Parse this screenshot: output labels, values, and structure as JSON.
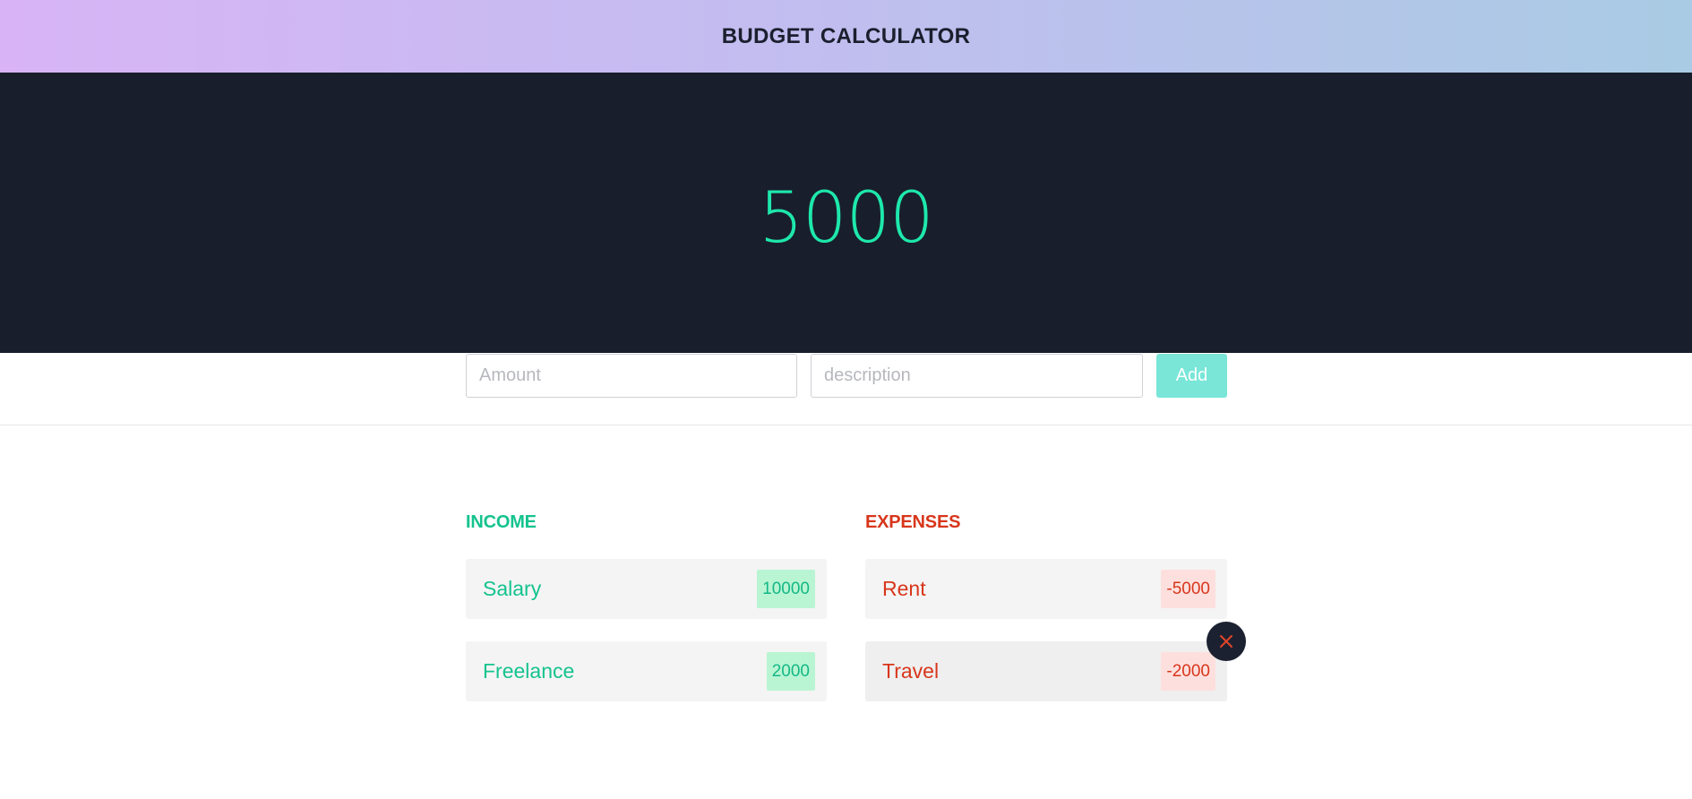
{
  "header": {
    "title": "BUDGET CALCULATOR"
  },
  "balance": {
    "value": "5000"
  },
  "form": {
    "amount_placeholder": "Amount",
    "description_placeholder": "description",
    "add_label": "Add"
  },
  "income": {
    "title": "INCOME",
    "items": [
      {
        "label": "Salary",
        "amount": "10000"
      },
      {
        "label": "Freelance",
        "amount": "2000"
      }
    ]
  },
  "expenses": {
    "title": "EXPENSES",
    "items": [
      {
        "label": "Rent",
        "amount": "-5000"
      },
      {
        "label": "Travel",
        "amount": "-2000"
      }
    ]
  },
  "colors": {
    "header_gradient_start": "#d8b4f6",
    "header_gradient_end": "#a9cbe4",
    "hero_background": "#181e2c",
    "balance_color": "#1ee8ac",
    "income_color": "#14c38e",
    "expense_color": "#d8361b",
    "add_button": "#79e6d8"
  },
  "icons": {
    "delete": "close-icon"
  }
}
